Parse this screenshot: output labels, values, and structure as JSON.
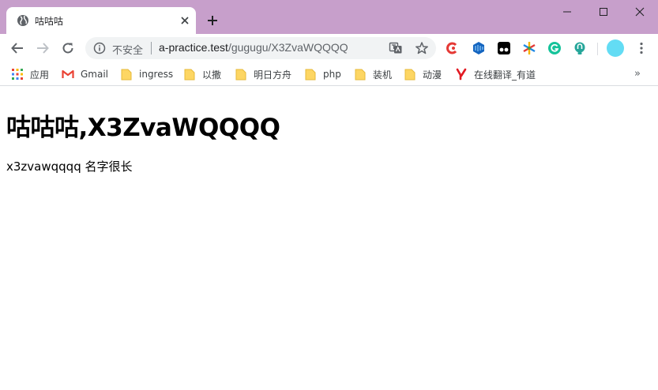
{
  "tab": {
    "title": "咕咕咕",
    "favicon": "globe-icon"
  },
  "window_controls": [
    "minimize-icon",
    "maximize-icon",
    "close-icon"
  ],
  "omnibox": {
    "security_label": "不安全",
    "url_host": "a-practice.test",
    "url_path": "/gugugu/X3ZvaWQQQQ"
  },
  "bookmarks": [
    {
      "label": "应用",
      "icon": "apps-grid-icon"
    },
    {
      "label": "Gmail",
      "icon": "gmail-icon"
    },
    {
      "label": "ingress",
      "icon": "folder-icon"
    },
    {
      "label": "以撒",
      "icon": "folder-icon"
    },
    {
      "label": "明日方舟",
      "icon": "folder-icon"
    },
    {
      "label": "php",
      "icon": "folder-icon"
    },
    {
      "label": "装机",
      "icon": "folder-icon"
    },
    {
      "label": "动漫",
      "icon": "folder-icon"
    },
    {
      "label": "在线翻译_有道",
      "icon": "youdao-icon"
    }
  ],
  "bookmarks_overflow": "»",
  "page": {
    "heading": "咕咕咕,X3ZvaWQQQQ",
    "text": "x3zvawqqqq 名字很长"
  },
  "colors": {
    "titlebar": "#c79fcb",
    "avatar": "#63dcf4"
  }
}
